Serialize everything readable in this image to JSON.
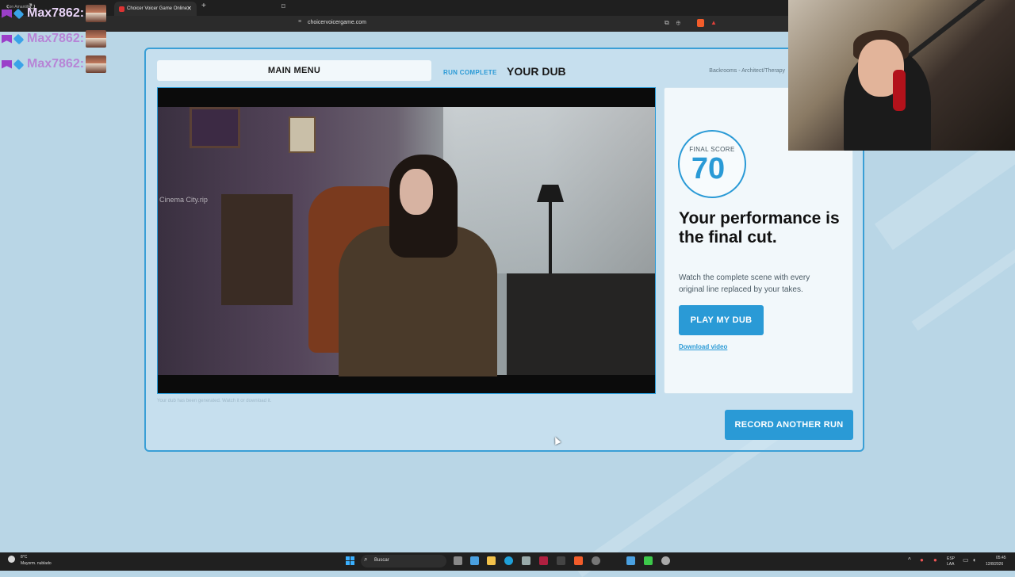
{
  "browser": {
    "profile_label": "Con Amantillo",
    "tab_title": "Choicer Voicer Game Online",
    "url": "choicervoicergame.com"
  },
  "chat": {
    "lines": [
      {
        "name": "Max7862:",
        "name_color": "#d8b2f0"
      },
      {
        "name": "Max7862:",
        "name_color": "#b784d6"
      },
      {
        "name": "Max7862:",
        "name_color": "#b784d6"
      }
    ]
  },
  "app": {
    "main_menu_label": "MAIN MENU",
    "run_status": "RUN COMPLETE",
    "section_title": "YOUR DUB",
    "breadcrumb": "Backrooms - Architect/Therapy",
    "video_watermark": "Cinema City.rip",
    "video_hint": "Your dub has been generated. Watch it or download it.",
    "score": {
      "label": "FINAL SCORE",
      "value": "70"
    },
    "headline": "Your performance is the final cut.",
    "description": "Watch the complete scene with every original line replaced by your takes.",
    "play_button": "PLAY MY DUB",
    "download_link": "Download video",
    "record_button": "RECORD ANOTHER RUN",
    "accent_color": "#2a9ad6"
  },
  "taskbar": {
    "weather_temp": "8°C",
    "weather_desc": "Mayorm. nublado",
    "search_placeholder": "Buscar",
    "lang": "ESP",
    "lang_sub": "LAA",
    "time": "05:45",
    "date": "12/8/2026"
  }
}
